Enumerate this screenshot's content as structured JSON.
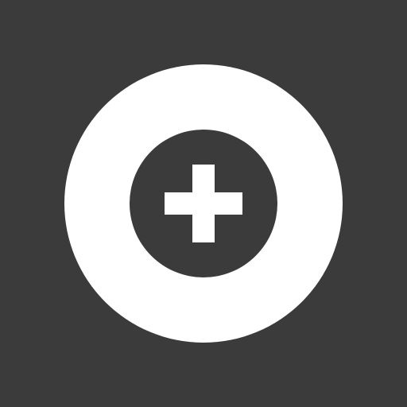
{
  "icon": {
    "name": "add-icon",
    "background_color": "#3b3b3b",
    "ring_color": "#ffffff",
    "center_color": "#3b3b3b",
    "plus_color": "#ffffff"
  }
}
